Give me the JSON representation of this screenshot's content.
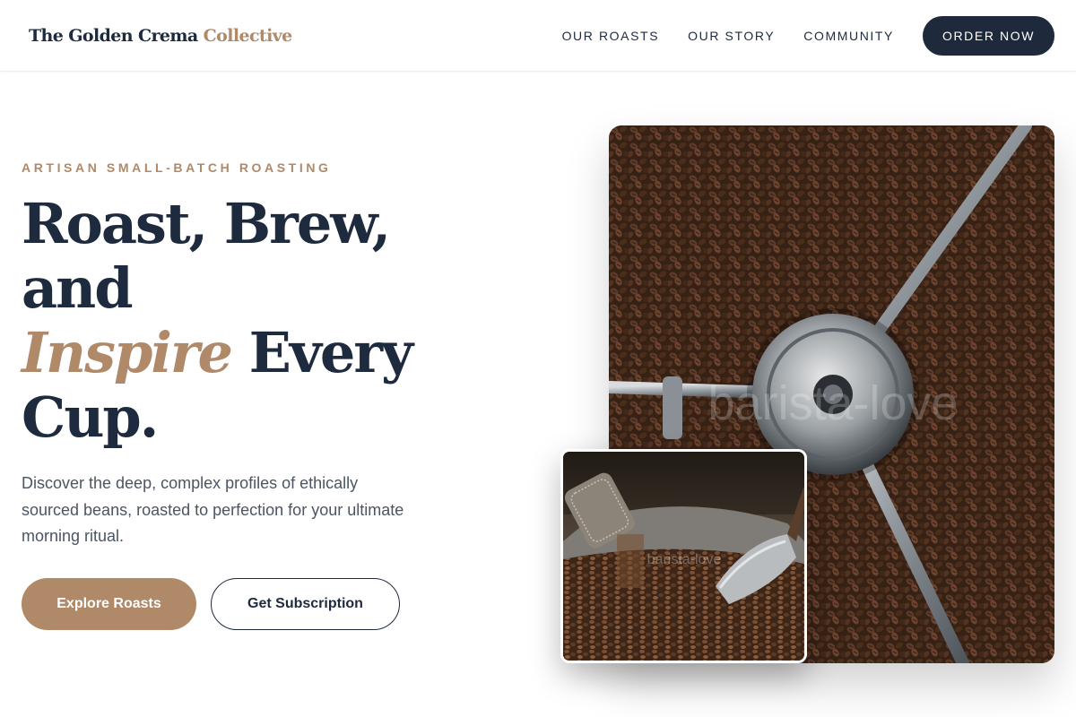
{
  "header": {
    "logo_main": "The Golden Crema",
    "logo_accent": "Collective",
    "nav": [
      "OUR ROASTS",
      "OUR STORY",
      "COMMUNITY"
    ],
    "cta_label": "ORDER NOW"
  },
  "hero": {
    "eyebrow": "ARTISAN SMALL-BATCH ROASTING",
    "headline_line1": "Roast, Brew,",
    "headline_line2": "and",
    "headline_em": "Inspire",
    "headline_line3_rest": "Every",
    "headline_line4": "Cup.",
    "lede": "Discover the deep, complex profiles of ethically sourced beans, roasted to perfection for your ultimate morning ritual.",
    "primary_label": "Explore Roasts",
    "secondary_label": "Get Subscription"
  },
  "images": {
    "main_watermark": "barista-love",
    "inset_watermark": "barista-love"
  },
  "colors": {
    "navy": "#1e293b",
    "accent": "#b08968",
    "text_muted": "#4b5563"
  }
}
